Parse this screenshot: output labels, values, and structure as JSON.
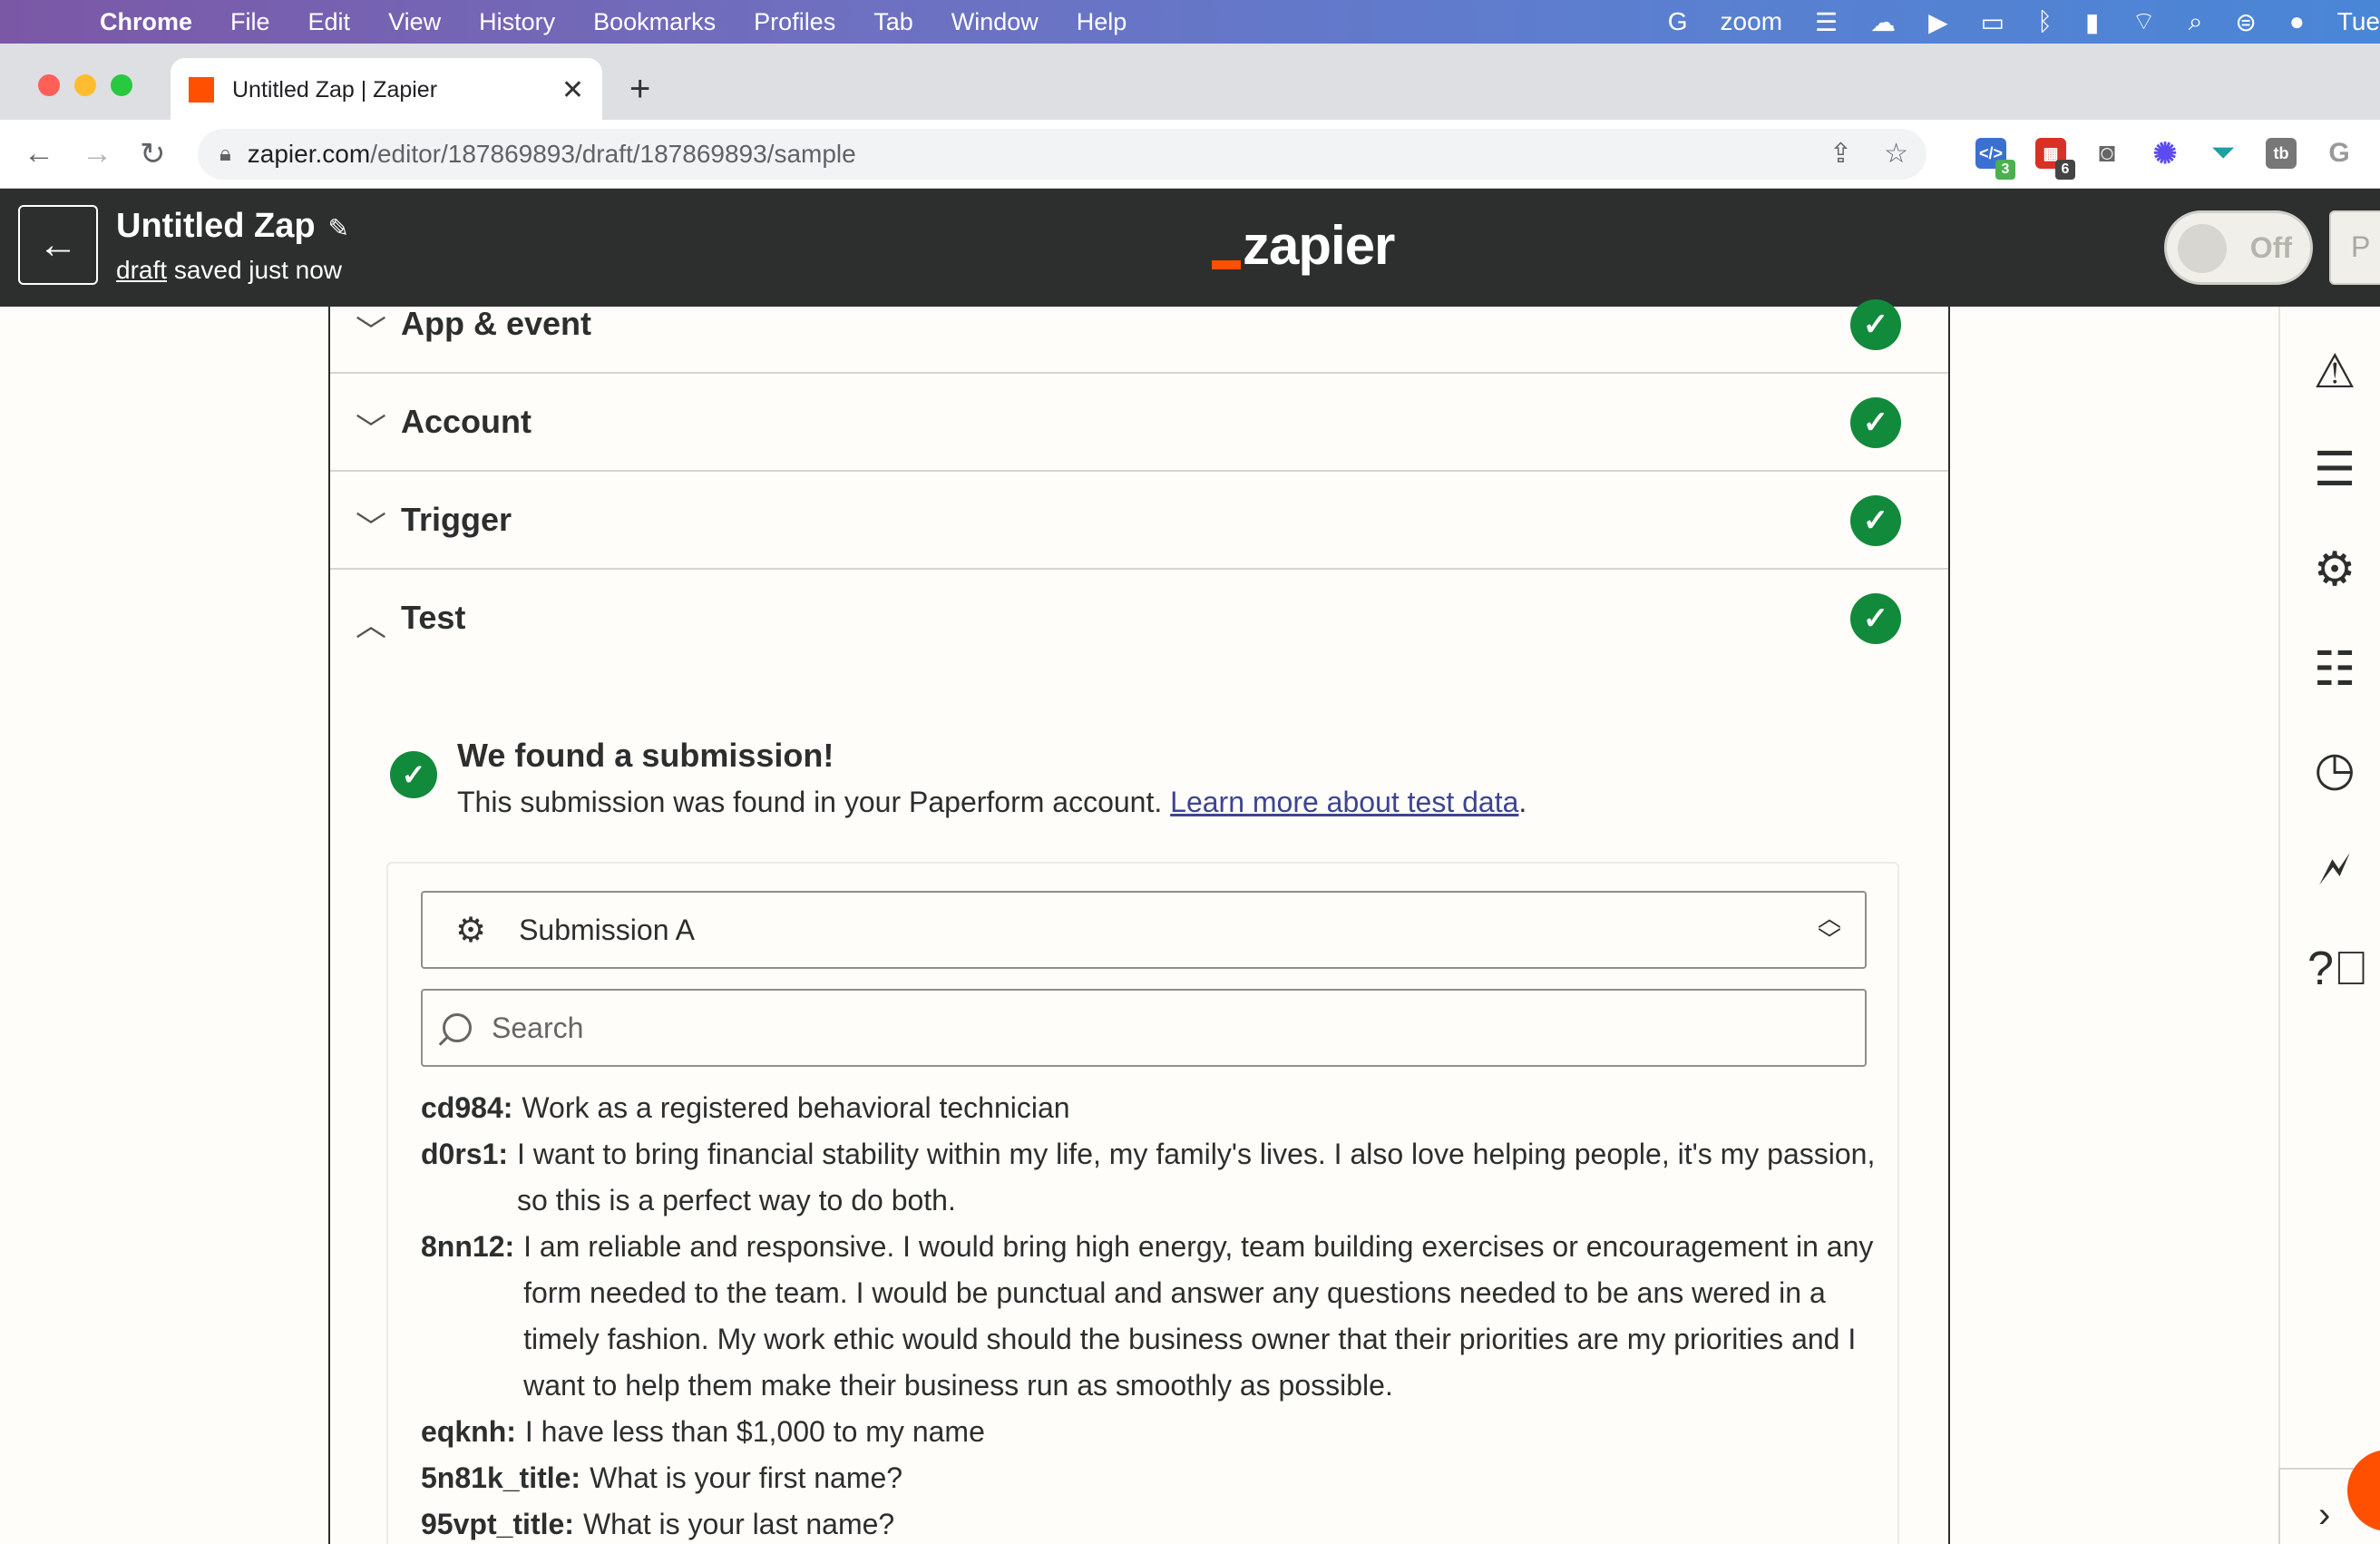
{
  "menubar": {
    "app": "Chrome",
    "items": [
      "File",
      "Edit",
      "View",
      "History",
      "Bookmarks",
      "Profiles",
      "Tab",
      "Window",
      "Help"
    ],
    "right_zoom": "zoom",
    "clock": "Tue"
  },
  "browser": {
    "tab_title": "Untitled Zap | Zapier",
    "url_domain": "zapier.com",
    "url_path": "/editor/187869893/draft/187869893/sample",
    "ext_badges": [
      "3",
      "6"
    ]
  },
  "zap": {
    "title": "Untitled Zap",
    "draft_link": "draft",
    "draft_status": "saved just now",
    "logo_text": "zapier",
    "toggle_label": "Off",
    "publish_partial": "P"
  },
  "sections": [
    {
      "label": "App & event",
      "expanded": false
    },
    {
      "label": "Account",
      "expanded": false
    },
    {
      "label": "Trigger",
      "expanded": false
    },
    {
      "label": "Test",
      "expanded": true
    }
  ],
  "test": {
    "found_title": "We found a submission!",
    "found_desc": "This submission was found in your Paperform account. ",
    "learn_link": "Learn more about test data",
    "desc_end": ".",
    "selected_submission": "Submission A",
    "search_placeholder": "Search",
    "fields": [
      {
        "key": "cd984:",
        "value": "Work as a registered behavioral technician"
      },
      {
        "key": "d0rs1:",
        "value": "I want to bring financial stability within my life, my family's lives. I also love helping people, it's my passion, so this is a perfect way to do both."
      },
      {
        "key": "8nn12:",
        "value": "I am reliable and responsive. I would bring high energy, team building exercises or encouragement in any form needed to the team. I would be punctual and answer any questions needed to be ans wered in a timely fashion. My work ethic would should the business owner that their priorities are my priorities and I want to help them make their business run as smoothly as possible."
      },
      {
        "key": "eqknh:",
        "value": "I have less than $1,000 to my name"
      },
      {
        "key": "5n81k_title:",
        "value": "What is your first name?"
      },
      {
        "key": "95vpt_title:",
        "value": "What is your last name?"
      }
    ]
  },
  "colors": {
    "brand_orange": "#ff4f00",
    "success_green": "#128a3c",
    "header_dark": "#2d2e2e",
    "link_blue": "#3d4592"
  }
}
